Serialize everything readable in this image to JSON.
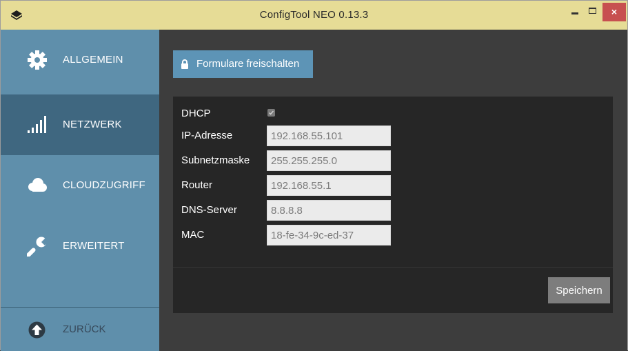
{
  "window": {
    "title": "ConfigTool NEO 0.13.3",
    "close_glyph": "×",
    "colors": {
      "titlebar": "#e6dc96",
      "sidebar": "#5f8fab",
      "sidebar_active": "#3f6780",
      "accent": "#5d94b6",
      "close": "#c75050"
    }
  },
  "sidebar": {
    "items": [
      {
        "label": "ALLGEMEIN",
        "icon": "gear-icon",
        "active": false
      },
      {
        "label": "NETZWERK",
        "icon": "signal-bars-icon",
        "active": true
      },
      {
        "label": "CLOUDZUGRIFF",
        "icon": "cloud-icon",
        "active": false
      },
      {
        "label": "ERWEITERT",
        "icon": "wrench-icon",
        "active": false
      }
    ],
    "back": {
      "label": "ZURÜCK",
      "icon": "arrow-up-circle-icon"
    }
  },
  "main": {
    "unlock_button": {
      "label": "Formulare freischalten",
      "icon": "lock-icon"
    },
    "form": {
      "dhcp": {
        "label": "DHCP",
        "checked": true
      },
      "fields": [
        {
          "label": "IP-Adresse",
          "value": "192.168.55.101"
        },
        {
          "label": "Subnetzmaske",
          "value": "255.255.255.0"
        },
        {
          "label": "Router",
          "value": "192.168.55.1"
        },
        {
          "label": "DNS-Server",
          "value": "8.8.8.8"
        },
        {
          "label": "MAC",
          "value": "18-fe-34-9c-ed-37"
        }
      ]
    },
    "save_button": {
      "label": "Speichern"
    }
  }
}
